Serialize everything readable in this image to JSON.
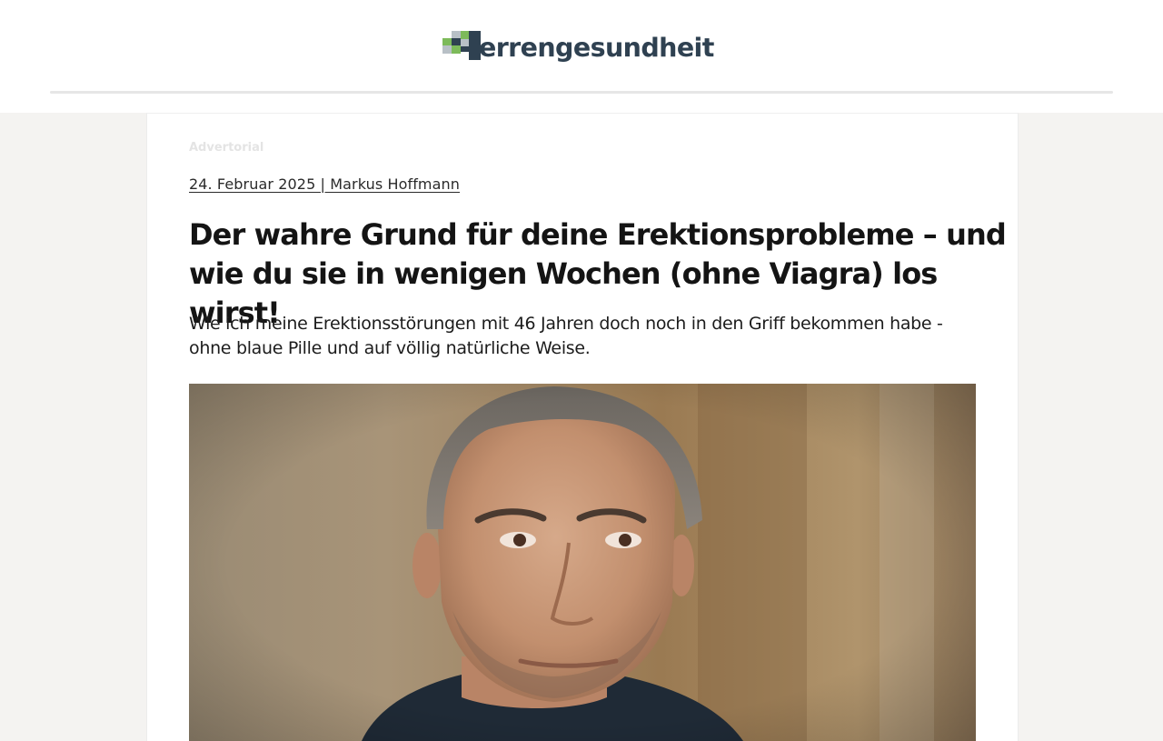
{
  "header": {
    "logo_text": "errengesundheit",
    "logo_icon": "pixel-h-logo-icon",
    "colors": {
      "logo_dark": "#2f4151",
      "logo_green": "#7dba5a",
      "logo_gray": "#b8c0c6"
    }
  },
  "article": {
    "label": "Advertorial",
    "date_author": "24. Februar 2025 | Markus Hoffmann",
    "title": "Der wahre Grund für deine Erektionsprobleme – und wie du sie in wenigen Wochen (ohne Viagra) los wirst!",
    "subtitle": "Wie ich meine Erektionsstörungen mit 46 Jahren doch noch in den Griff bekommen habe - ohne blaue Pille und auf völlig natürliche Weise.",
    "hero_image": "man-portrait-image"
  }
}
